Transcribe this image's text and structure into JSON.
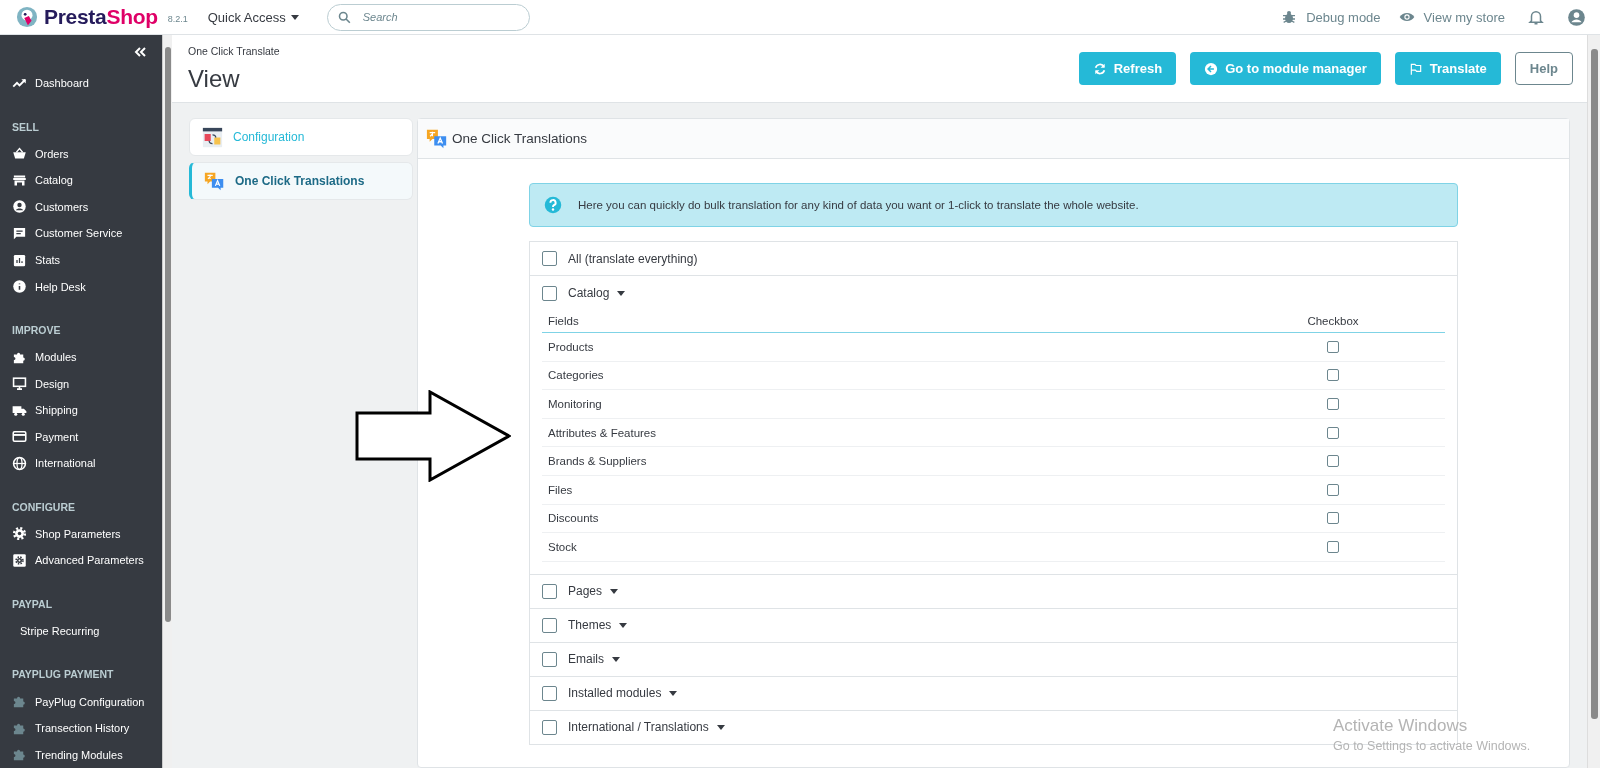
{
  "topbar": {
    "logo": [
      "Presta",
      "Shop"
    ],
    "version": "8.2.1",
    "quick_access": "Quick Access",
    "search": {
      "placeholder": "Search"
    },
    "links": [
      {
        "kind": "bug",
        "label": "Debug mode"
      },
      {
        "kind": "eye",
        "label": "View my store"
      }
    ]
  },
  "sidebar": {
    "sections": [
      {
        "items": [
          {
            "kind": "trend",
            "label": "Dashboard"
          }
        ]
      },
      {
        "title": "SELL",
        "items": [
          {
            "kind": "basket",
            "label": "Orders"
          },
          {
            "kind": "store",
            "label": "Catalog"
          },
          {
            "kind": "person",
            "label": "Customers"
          },
          {
            "kind": "chat",
            "label": "Customer Service"
          },
          {
            "kind": "chart",
            "label": "Stats"
          },
          {
            "kind": "info",
            "label": "Help Desk"
          }
        ]
      },
      {
        "title": "IMPROVE",
        "items": [
          {
            "kind": "puzzle",
            "label": "Modules"
          },
          {
            "kind": "monitor",
            "label": "Design"
          },
          {
            "kind": "truck",
            "label": "Shipping"
          },
          {
            "kind": "card",
            "label": "Payment"
          },
          {
            "kind": "globe",
            "label": "International"
          }
        ]
      },
      {
        "title": "CONFIGURE",
        "items": [
          {
            "kind": "gear",
            "label": "Shop Parameters"
          },
          {
            "kind": "gearbox",
            "label": "Advanced Parameters"
          }
        ]
      },
      {
        "title": "PAYPAL",
        "items": [
          {
            "kind": "plain",
            "label": "Stripe Recurring"
          }
        ]
      },
      {
        "title": "PAYPLUG PAYMENT",
        "items": [
          {
            "kind": "module",
            "label": "PayPlug Configuration"
          },
          {
            "kind": "module",
            "label": "Transection History"
          },
          {
            "kind": "module",
            "label": "Trending Modules"
          }
        ]
      }
    ]
  },
  "breadcrumb": "One Click Translate",
  "page_title": "View",
  "toolbar": [
    {
      "kind": "refresh",
      "label": "Refresh"
    },
    {
      "kind": "back",
      "label": "Go to module manager"
    },
    {
      "kind": "flag",
      "label": "Translate"
    },
    {
      "kind": "help",
      "label": "Help"
    }
  ],
  "tabs": [
    {
      "label": "Configuration",
      "selected": false
    },
    {
      "label": "One Click Translations",
      "selected": true
    }
  ],
  "panel": {
    "title": "One Click Translations",
    "info": "Here you can quickly do bulk translation for any kind of data you want or 1-click to translate the whole website.",
    "options": [
      {
        "label": "All (translate everything)",
        "checked": false,
        "dropdown": false
      },
      {
        "label": "Catalog",
        "checked": false,
        "dropdown": true,
        "columns": [
          "Fields",
          "Checkbox"
        ],
        "fields": [
          {
            "label": "Products",
            "checked": false
          },
          {
            "label": "Categories",
            "checked": false
          },
          {
            "label": "Monitoring",
            "checked": false
          },
          {
            "label": "Attributes & Features",
            "checked": false
          },
          {
            "label": "Brands & Suppliers",
            "checked": false
          },
          {
            "label": "Files",
            "checked": false
          },
          {
            "label": "Discounts",
            "checked": false
          },
          {
            "label": "Stock",
            "checked": false
          }
        ]
      },
      {
        "label": "Pages",
        "checked": false,
        "dropdown": true
      },
      {
        "label": "Themes",
        "checked": false,
        "dropdown": true
      },
      {
        "label": "Emails",
        "checked": false,
        "dropdown": true
      },
      {
        "label": "Installed modules",
        "checked": false,
        "dropdown": true
      },
      {
        "label": "International / Translations",
        "checked": false,
        "dropdown": true
      }
    ]
  },
  "os_notice": {
    "title": "Activate Windows",
    "text": "Go to Settings to activate Windows."
  }
}
